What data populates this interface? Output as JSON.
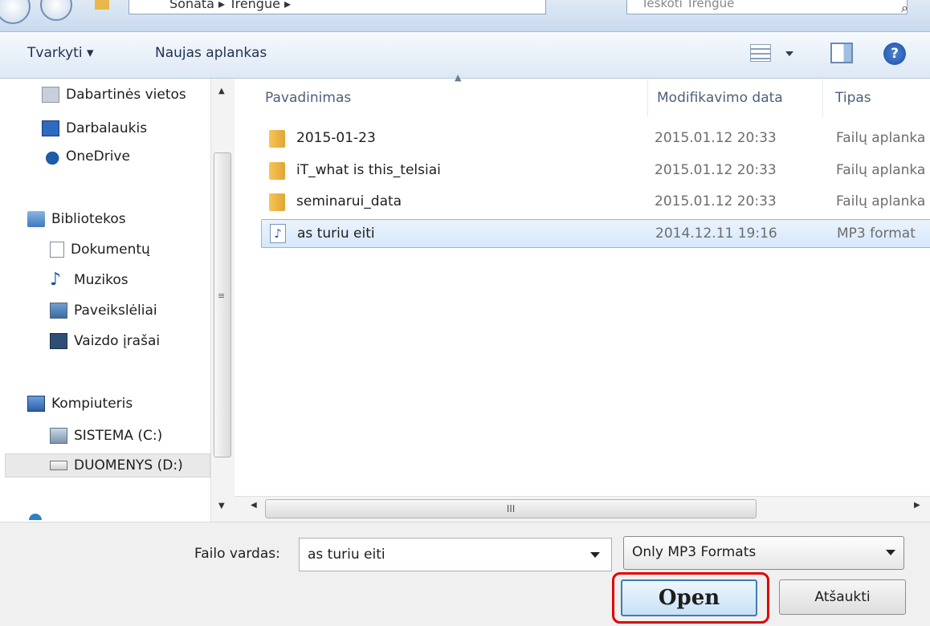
{
  "address": {
    "path": "Sonata  ▸  Trengue  ▸",
    "search_placeholder": "Ieškoti Trengue"
  },
  "toolbar": {
    "organize": "Tvarkyti ▾",
    "new_folder": "Naujas aplankas"
  },
  "sidebar": {
    "items": [
      {
        "label": "Dabartinės vietos",
        "icon": "recent-places-icon"
      },
      {
        "label": "Darbalaukis",
        "icon": "desktop-icon"
      },
      {
        "label": "OneDrive",
        "icon": "onedrive-icon"
      },
      {
        "label": "Bibliotekos",
        "icon": "libraries-icon"
      },
      {
        "label": "Dokumentų",
        "icon": "documents-icon"
      },
      {
        "label": "Muzikos",
        "icon": "music-icon"
      },
      {
        "label": "Paveikslėliai",
        "icon": "pictures-icon"
      },
      {
        "label": "Vaizdo įrašai",
        "icon": "videos-icon"
      },
      {
        "label": "Kompiuteris",
        "icon": "computer-icon"
      },
      {
        "label": "SISTEMA (C:)",
        "icon": "drive-c-icon"
      },
      {
        "label": "DUOMENYS (D:)",
        "icon": "drive-d-icon"
      }
    ]
  },
  "filelist": {
    "headers": {
      "name": "Pavadinimas",
      "modified": "Modifikavimo data",
      "type": "Tipas"
    },
    "rows": [
      {
        "name": "2015-01-23",
        "modified": "2015.01.12 20:33",
        "type": "Failų aplanka",
        "kind": "folder"
      },
      {
        "name": "iT_what is this_telsiai",
        "modified": "2015.01.12 20:33",
        "type": "Failų aplanka",
        "kind": "folder"
      },
      {
        "name": "seminarui_data",
        "modified": "2015.01.12 20:33",
        "type": "Failų aplanka",
        "kind": "folder"
      },
      {
        "name": "as turiu eiti",
        "modified": "2014.12.11 19:16",
        "type": "MP3 format",
        "kind": "mp3",
        "selected": true
      }
    ]
  },
  "bottom": {
    "filename_label": "Failo vardas:",
    "filename_value": "as turiu eiti",
    "filter_value": "Only MP3 Formats",
    "open_label": "Open",
    "cancel_label": "Atšaukti"
  },
  "colors": {
    "highlight": "#e00000",
    "selection": "#d6e8fb"
  }
}
